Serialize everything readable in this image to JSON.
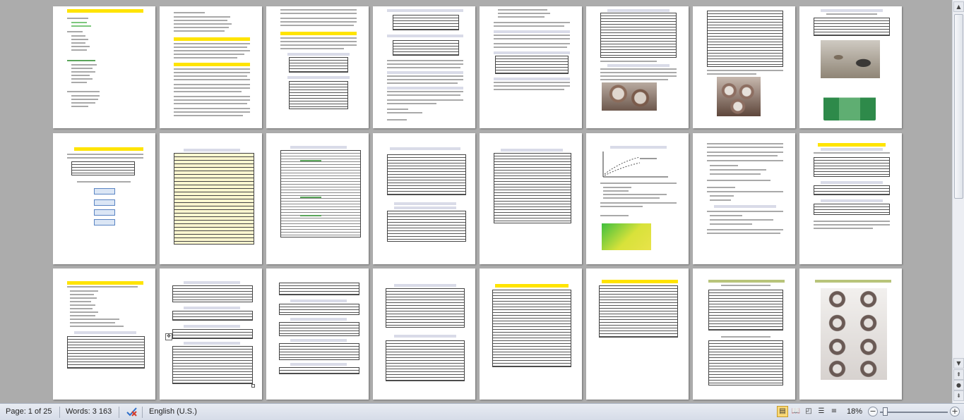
{
  "status_bar": {
    "page_indicator": "Page: 1 of 25",
    "word_count": "Words: 3 163",
    "language": "English (U.S.)",
    "zoom_level": "18%",
    "zoom_in_symbol": "+",
    "zoom_out_symbol": "−"
  },
  "view_buttons": [
    {
      "name": "print-layout-view-button",
      "icon": "print-layout-icon",
      "active": true
    },
    {
      "name": "full-screen-reading-view-button",
      "icon": "open-book-icon",
      "active": false
    },
    {
      "name": "web-layout-view-button",
      "icon": "web-layout-icon",
      "active": false
    },
    {
      "name": "outline-view-button",
      "icon": "outline-icon",
      "active": false
    },
    {
      "name": "draft-view-button",
      "icon": "draft-icon",
      "active": false
    }
  ],
  "scrollbar": {
    "up_arrow": "▲",
    "down_arrow": "▼",
    "prev_page": "⇞",
    "next_page": "⇟",
    "select_browse": "●"
  },
  "colors": {
    "background": "#acacac",
    "heading_highlight": "#ffe400",
    "table_header_fill": "#fbf6cf",
    "active_view_button": "#fbd976",
    "status_bar": "#d6dce8"
  },
  "document": {
    "total_pages": 25,
    "visible_thumbnail_pages": 24
  }
}
